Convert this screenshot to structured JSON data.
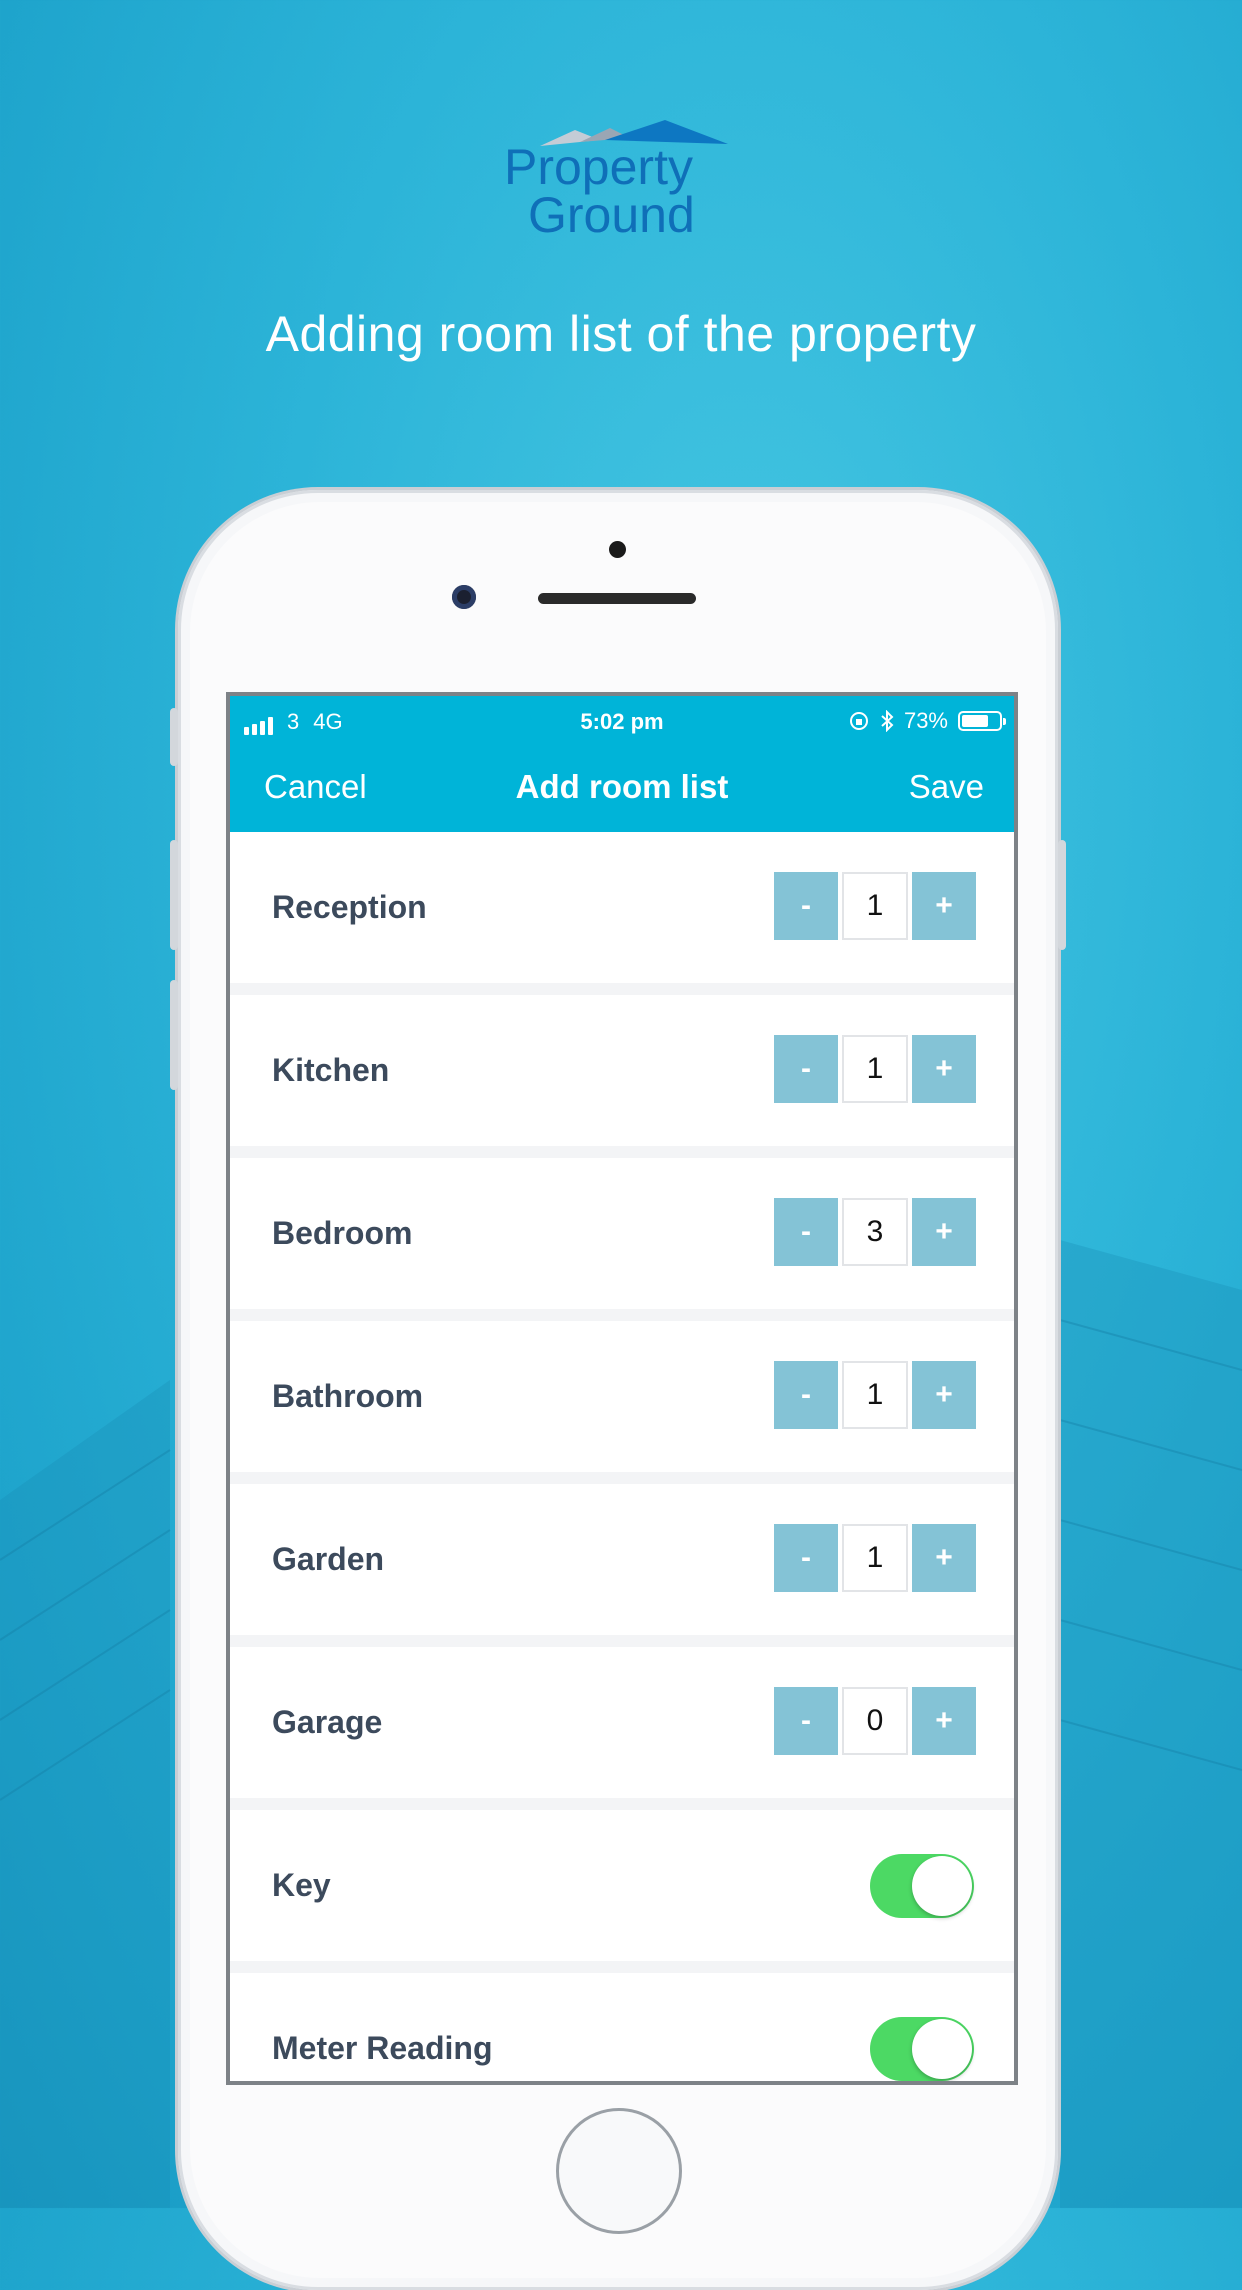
{
  "brand": {
    "logo_line1": "Property",
    "logo_line2": "Ground"
  },
  "headline": "Adding room list of the property",
  "status_bar": {
    "carrier": "3",
    "network": "4G",
    "time": "5:02 pm",
    "battery_percent": "73%",
    "battery_level": 0.73
  },
  "nav": {
    "cancel_label": "Cancel",
    "title": "Add room list",
    "save_label": "Save"
  },
  "stepper": {
    "minus_label": "-",
    "plus_label": "+"
  },
  "rooms": [
    {
      "label": "Reception",
      "value": "1"
    },
    {
      "label": "Kitchen",
      "value": "1"
    },
    {
      "label": "Bedroom",
      "value": "3"
    },
    {
      "label": "Bathroom",
      "value": "1"
    },
    {
      "label": "Garden",
      "value": "1"
    },
    {
      "label": "Garage",
      "value": "0"
    }
  ],
  "toggles": [
    {
      "label": "Key",
      "on": true
    },
    {
      "label": "Meter Reading",
      "on": true
    }
  ],
  "colors": {
    "accent": "#00b4d8",
    "stepper": "#84c3d6",
    "toggle_on": "#4cd964",
    "label": "#3c4a5c"
  }
}
